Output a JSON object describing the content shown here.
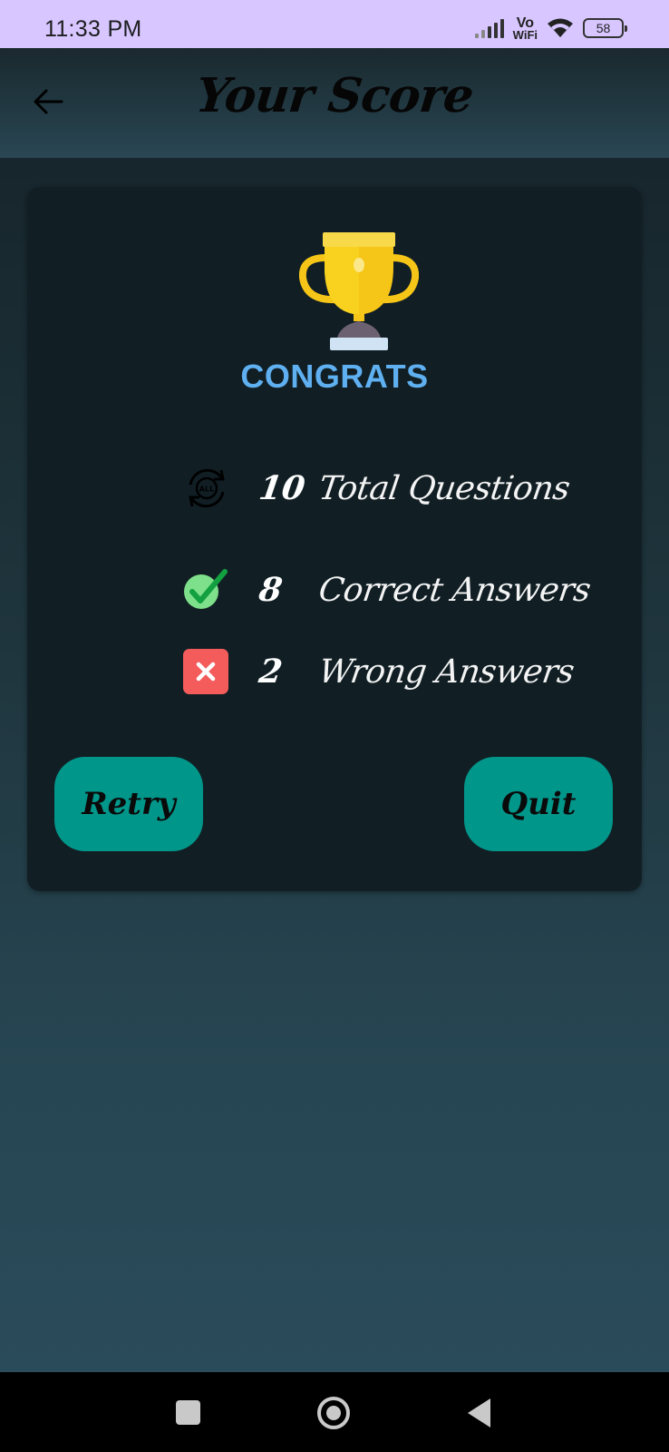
{
  "status_bar": {
    "time": "11:33 PM",
    "vowifi_top": "Vo",
    "vowifi_bottom": "WiFi",
    "battery": "58",
    "icons": [
      "signal-icon",
      "vowifi-icon",
      "wifi-icon",
      "battery-icon"
    ]
  },
  "header": {
    "title": "Your Score",
    "back_icon": "arrow-left-icon"
  },
  "card": {
    "congrats": "CONGRATS",
    "trophy_icon": "trophy-icon",
    "stats": [
      {
        "icon": "all-cycle-icon",
        "value": "10",
        "label": "Total Questions"
      },
      {
        "icon": "check-icon",
        "value": "8",
        "label": "Correct Answers"
      },
      {
        "icon": "cross-icon",
        "value": "2",
        "label": "Wrong Answers"
      }
    ],
    "retry_label": "Retry",
    "quit_label": "Quit"
  },
  "nav": {
    "icons": [
      "recents-square-icon",
      "home-circle-icon",
      "back-triangle-icon"
    ]
  },
  "colors": {
    "status_bar": "#d7c6ff",
    "card": "#111f25",
    "congrats": "#5fb0f0",
    "button": "#01968a",
    "correct": "#7ee08a",
    "wrong": "#f45c5c",
    "trophy": "#f5c518"
  }
}
